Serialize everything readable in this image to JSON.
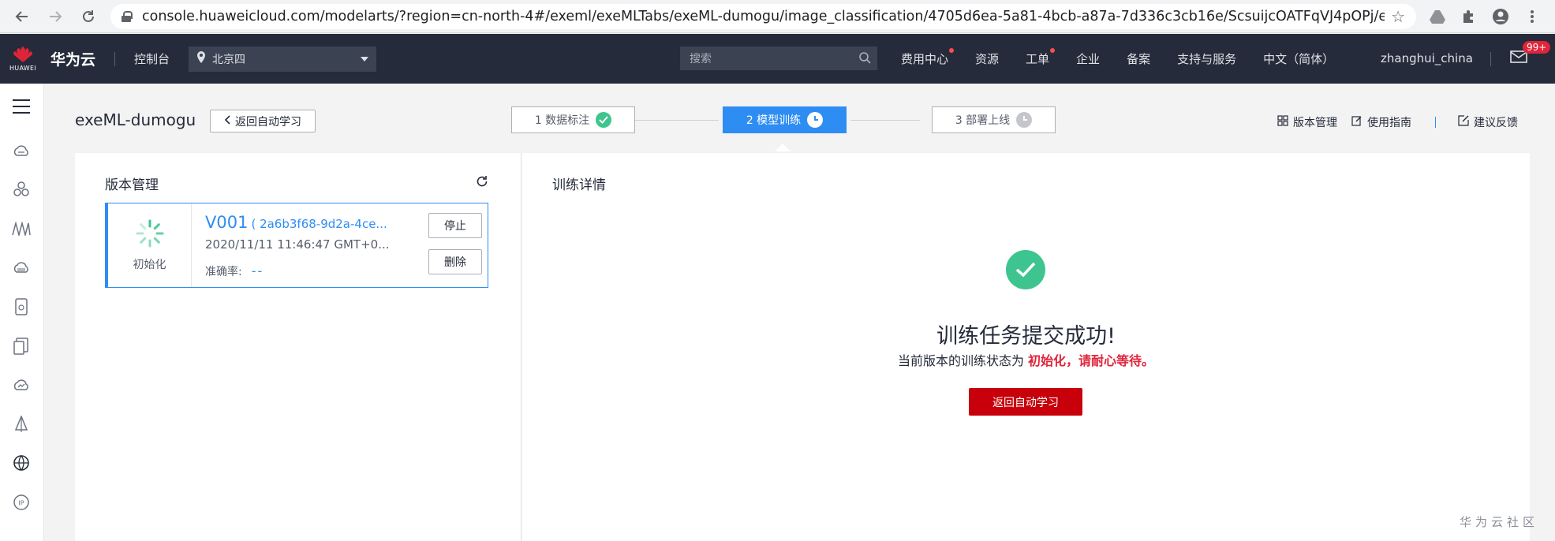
{
  "browser": {
    "url": "console.huaweicloud.com/modelarts/?region=cn-north-4#/exeml/exeMLTabs/exeML-dumogu/image_classification/4705d6ea-5a81-4bcb-a87a-7d336c3cb16e/ScsuijcOATFqVJ4pOPj/exeM..."
  },
  "header": {
    "logo_text": "HUAWEI",
    "brand": "华为云",
    "console": "控制台",
    "region": "北京四",
    "search_placeholder": "搜索",
    "links": [
      "费用中心",
      "资源",
      "工单",
      "企业",
      "备案",
      "支持与服务",
      "中文（简体）"
    ],
    "username": "zhanghui_china",
    "mail_badge": "99+"
  },
  "page": {
    "title": "exeML-dumogu",
    "back_label": "返回自动学习",
    "steps": [
      {
        "label": "1 数据标注",
        "state": "done"
      },
      {
        "label": "2 模型训练",
        "state": "active"
      },
      {
        "label": "3 部署上线",
        "state": "pending"
      }
    ],
    "right_links": [
      "版本管理",
      "使用指南",
      "建议反馈"
    ]
  },
  "left_panel": {
    "title": "版本管理",
    "version": {
      "status": "初始化",
      "name": "V001",
      "id": "( 2a6b3f68-9d2a-4ce...",
      "time": "2020/11/11 11:46:47 GMT+0...",
      "accuracy_label": "准确率:",
      "accuracy_value": "--",
      "stop_label": "停止",
      "delete_label": "删除"
    }
  },
  "right_panel": {
    "title": "训练详情",
    "success_title": "训练任务提交成功!",
    "success_prefix": "当前版本的训练状态为",
    "success_highlight": "初始化，请耐心等待。",
    "return_label": "返回自动学习"
  },
  "watermark": "华为云社区",
  "colors": {
    "accent": "#2e8df3",
    "brand_red": "#c7000b",
    "success": "#3ec58f",
    "topbar": "#252b3a"
  }
}
